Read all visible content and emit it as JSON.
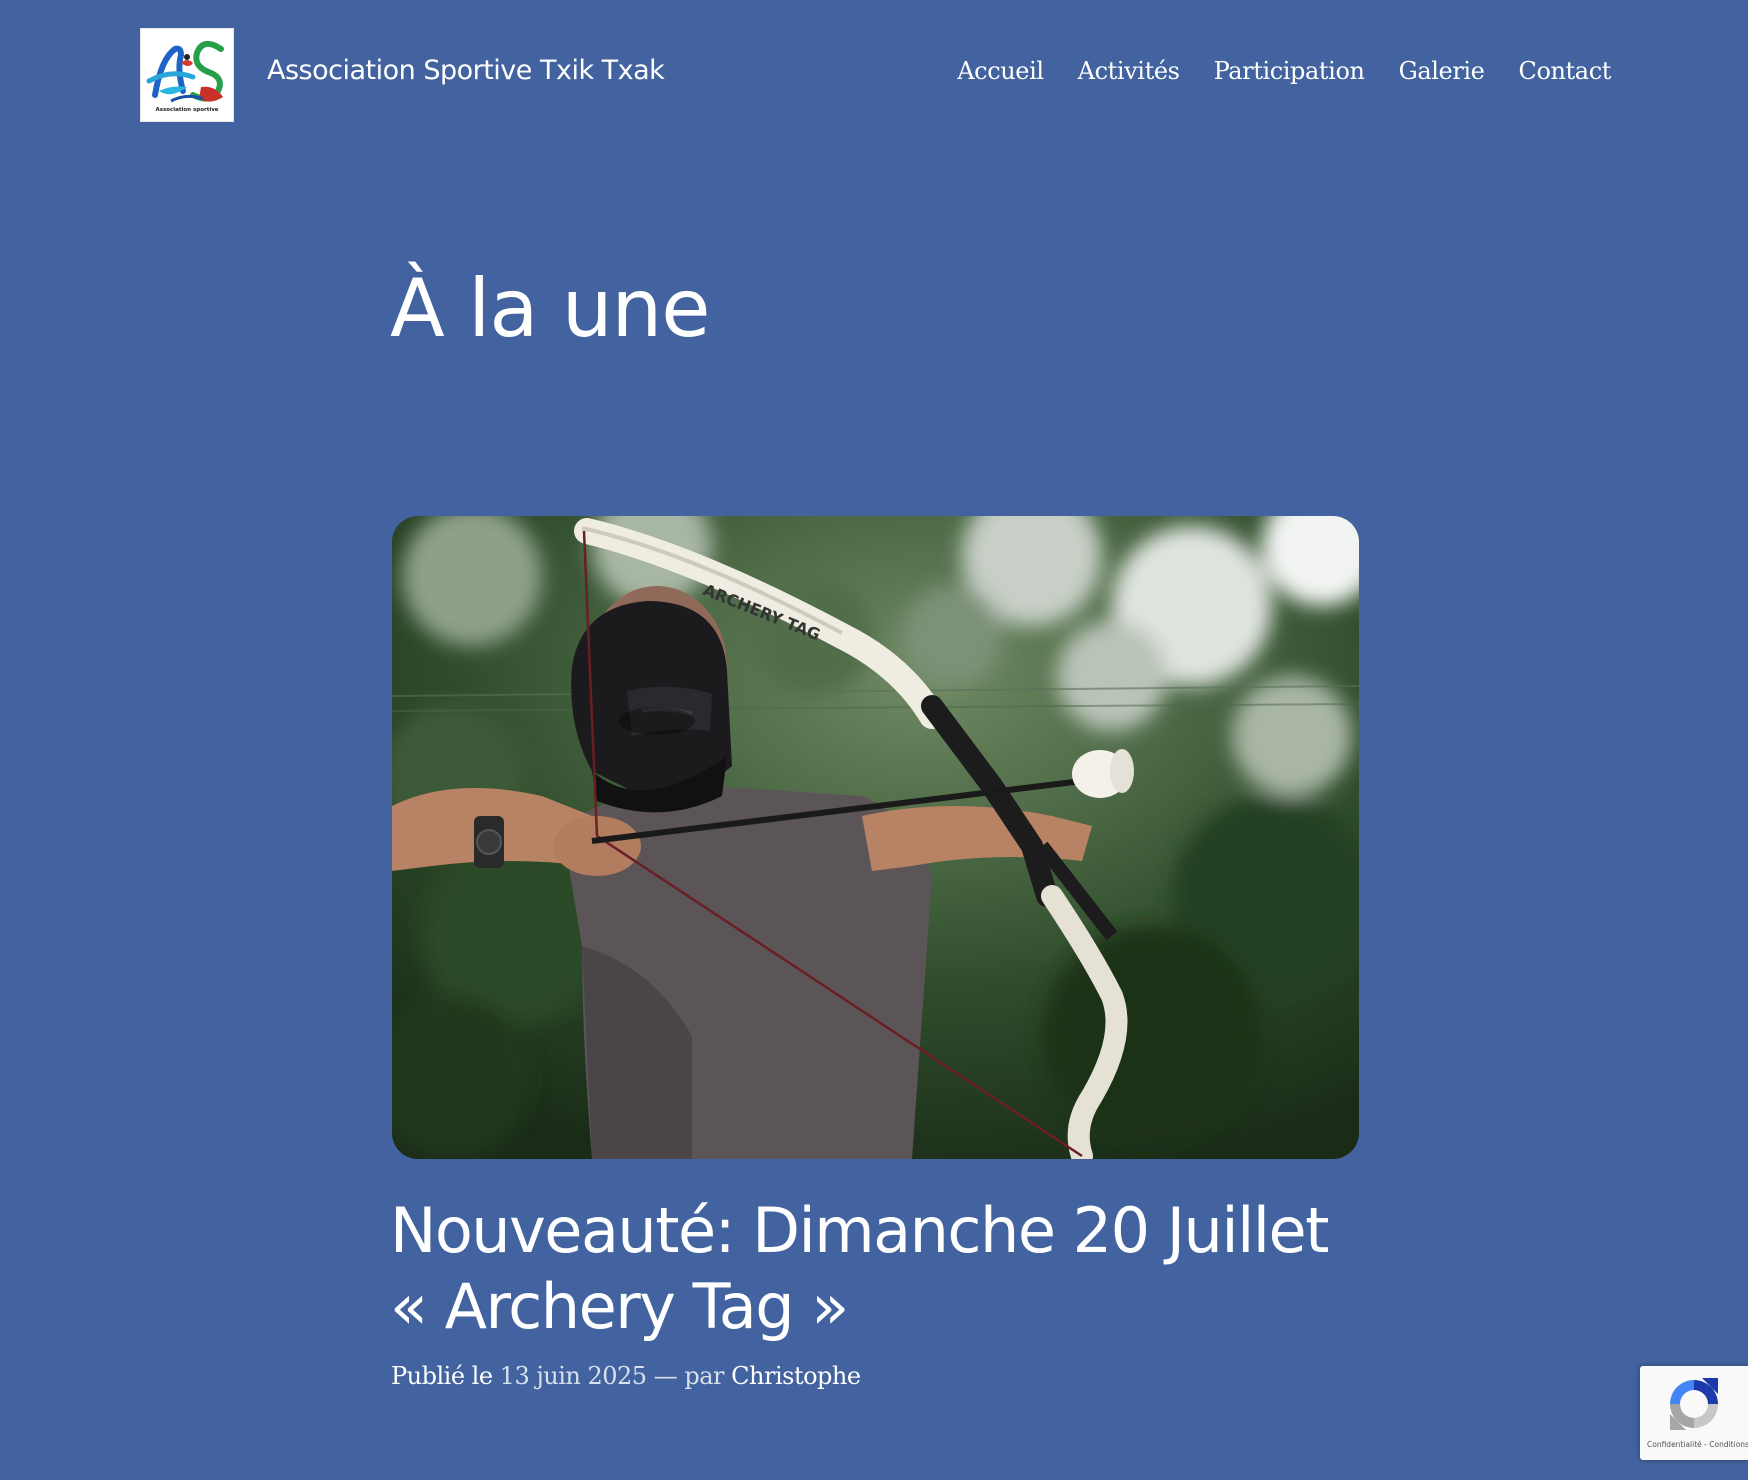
{
  "header": {
    "site_title": "Association Sportive Txik Txak",
    "logo_caption": "Association sportive",
    "nav": [
      "Accueil",
      "Activités",
      "Participation",
      "Galerie",
      "Contact"
    ]
  },
  "main": {
    "heading": "À la une",
    "post": {
      "title_line1": "Nouveauté: Dimanche 20 Juillet",
      "title_line2": "« Archery Tag »",
      "meta": {
        "published_label": "Publié le",
        "date": "13 juin 2025",
        "separator": "—",
        "by_label": "par",
        "author": "Christophe"
      },
      "image_bow_text": "ARCHERY TAG"
    }
  },
  "recaptcha": {
    "terms": "Confidentialité - Conditions"
  },
  "colors": {
    "background": "#42639f",
    "text": "#ffffff",
    "meta_soft": "#d8e0ee",
    "recaptcha_blue": "#1c3aa9",
    "recaptcha_grey": "#a6a6a6",
    "recaptcha_light_blue": "#4285f4"
  }
}
